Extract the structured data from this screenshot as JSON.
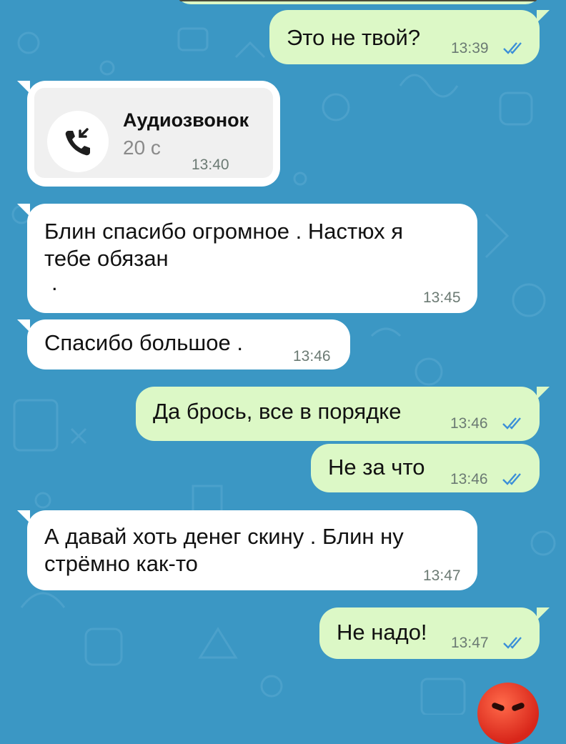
{
  "colors": {
    "background": "#3b97c4",
    "incoming_bubble": "#ffffff",
    "outgoing_bubble": "#dcf8c6",
    "read_ticks": "#3b8fd8",
    "time_text": "#6b7a73"
  },
  "messages": [
    {
      "direction": "out",
      "text": "Это не твой?",
      "time": "13:39",
      "status": "read"
    },
    {
      "direction": "in",
      "type": "call",
      "call": {
        "title": "Аудиозвонок",
        "duration": "20 с",
        "icon": "incoming-call-icon"
      },
      "time": "13:40"
    },
    {
      "direction": "in",
      "text_lines": [
        "Блин спасибо огромное . Настюх я",
        "тебе обязан",
        "."
      ],
      "time": "13:45"
    },
    {
      "direction": "in",
      "text": "Спасибо большое .",
      "time": "13:46"
    },
    {
      "direction": "out",
      "text": "Да брось, все в порядке",
      "time": "13:46",
      "status": "read"
    },
    {
      "direction": "out",
      "text": "Не за что",
      "time": "13:46",
      "status": "read"
    },
    {
      "direction": "in",
      "text_lines": [
        "А давай хоть денег скину . Блин ну",
        "стрёмно как-то"
      ],
      "time": "13:47"
    },
    {
      "direction": "out",
      "text": "Не надо!",
      "time": "13:47",
      "status": "read"
    }
  ],
  "partial_emoji": "angry-face-emoji"
}
